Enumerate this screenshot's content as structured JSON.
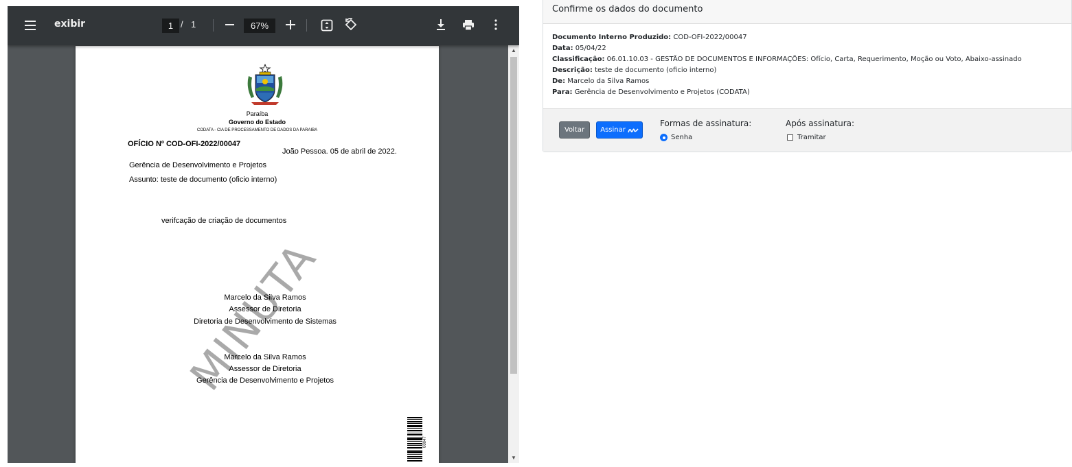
{
  "viewer": {
    "title": "exibir",
    "current_page": "1",
    "page_separator": "/",
    "total_pages": "1",
    "zoom": "67%",
    "icons": [
      "menu-icon",
      "zoom-out-icon",
      "zoom-in-icon",
      "fit-page-icon",
      "rotate-icon",
      "download-icon",
      "print-icon",
      "more-options-icon"
    ]
  },
  "document": {
    "state": "Paraíba",
    "government": "Governo do Estado",
    "organization": "CODATA - CIA DE PROCESSAMENTO DE DADOS DA PARAIBA",
    "oficio_number": "OFÍCIO Nº COD-OFI-2022/00047",
    "date_line": "João Pessoa. 05 de abril de 2022.",
    "recipient": "Gerência de Desenvolvimento e Projetos",
    "subject": "Assunto: teste de documento (oficio interno)",
    "body": "verifcação de criação de documentos",
    "watermark": "MINUTA",
    "signature1": {
      "name": "Marcelo da Silva Ramos",
      "role": "Assessor de Diretoria",
      "department": "Diretoria de Desenvolvimento de Sistemas"
    },
    "signature2": {
      "name": "Marcelo da Silva Ramos",
      "role": "Assessor de Diretoria",
      "department": "Gerência de Desenvolvimento e Projetos"
    },
    "barcode_text": "00047"
  },
  "panel": {
    "header": "Confirme os dados do documento",
    "fields": {
      "doc_label": "Documento Interno Produzido:",
      "doc_value": "COD-OFI-2022/00047",
      "date_label": "Data:",
      "date_value": "05/04/22",
      "class_label": "Classificação:",
      "class_value": "06.01.10.03 - GESTÃO DE DOCUMENTOS E INFORMAÇÕES: Ofício, Carta, Requerimento, Moção ou Voto, Abaixo-assinado",
      "desc_label": "Descrição:",
      "desc_value": "teste de documento (oficio interno)",
      "from_label": "De:",
      "from_value": "Marcelo da Silva Ramos",
      "to_label": "Para:",
      "to_value": "Gerência de Desenvolvimento e Projetos (CODATA)"
    },
    "buttons": {
      "back": "Voltar",
      "sign": "Assinar"
    },
    "signature_forms_label": "Formas de assinatura:",
    "signature_form_option": "Senha",
    "after_sign_label": "Após assinatura:",
    "after_sign_option": "Tramitar"
  },
  "colors": {
    "toolbar": "#323639",
    "viewer_bg": "#525659",
    "primary": "#0d6efd",
    "secondary": "#6c757d"
  }
}
